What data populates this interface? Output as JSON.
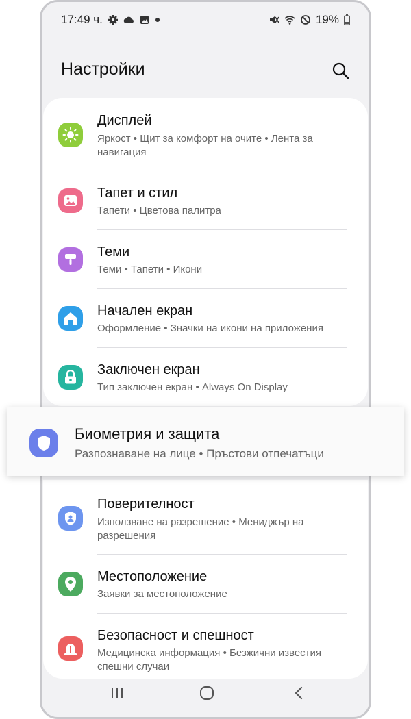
{
  "status": {
    "time": "17:49 ч.",
    "battery": "19%"
  },
  "header": {
    "title": "Настройки"
  },
  "items": [
    {
      "title": "Дисплей",
      "subtitle": "Яркост • Щит за комфорт на очите • Лента за навигация",
      "color": "#8fcd3b",
      "icon": "sun-icon"
    },
    {
      "title": "Тапет и стил",
      "subtitle": "Тапети • Цветова палитра",
      "color": "#ee6b8b",
      "icon": "image-icon"
    },
    {
      "title": "Теми",
      "subtitle": "Теми • Тапети • Икони",
      "color": "#b26fe0",
      "icon": "paint-roller-icon"
    },
    {
      "title": "Начален екран",
      "subtitle": "Оформление • Значки на икони на приложения",
      "color": "#2f9fe8",
      "icon": "home-icon"
    },
    {
      "title": "Заключен екран",
      "subtitle": "Тип заключен екран • Always On Display",
      "color": "#26b59f",
      "icon": "lock-icon"
    }
  ],
  "highlight": {
    "title": "Биометрия и защита",
    "subtitle": "Разпознаване на лице • Пръстови отпечатъци",
    "color": "#6b7fea",
    "icon": "shield-icon"
  },
  "items_bottom": [
    {
      "title": "Поверителност",
      "subtitle": "Използване на разрешение • Мениджър на разрешения",
      "color": "#6d95ef",
      "icon": "privacy-shield-icon"
    },
    {
      "title": "Местоположение",
      "subtitle": "Заявки за местоположение",
      "color": "#4caa5f",
      "icon": "location-pin-icon"
    },
    {
      "title": "Безопасност и спешност",
      "subtitle": "Медицинска информация • Безжични известия спешни случаи",
      "color": "#ec5f5f",
      "icon": "emergency-icon"
    }
  ]
}
